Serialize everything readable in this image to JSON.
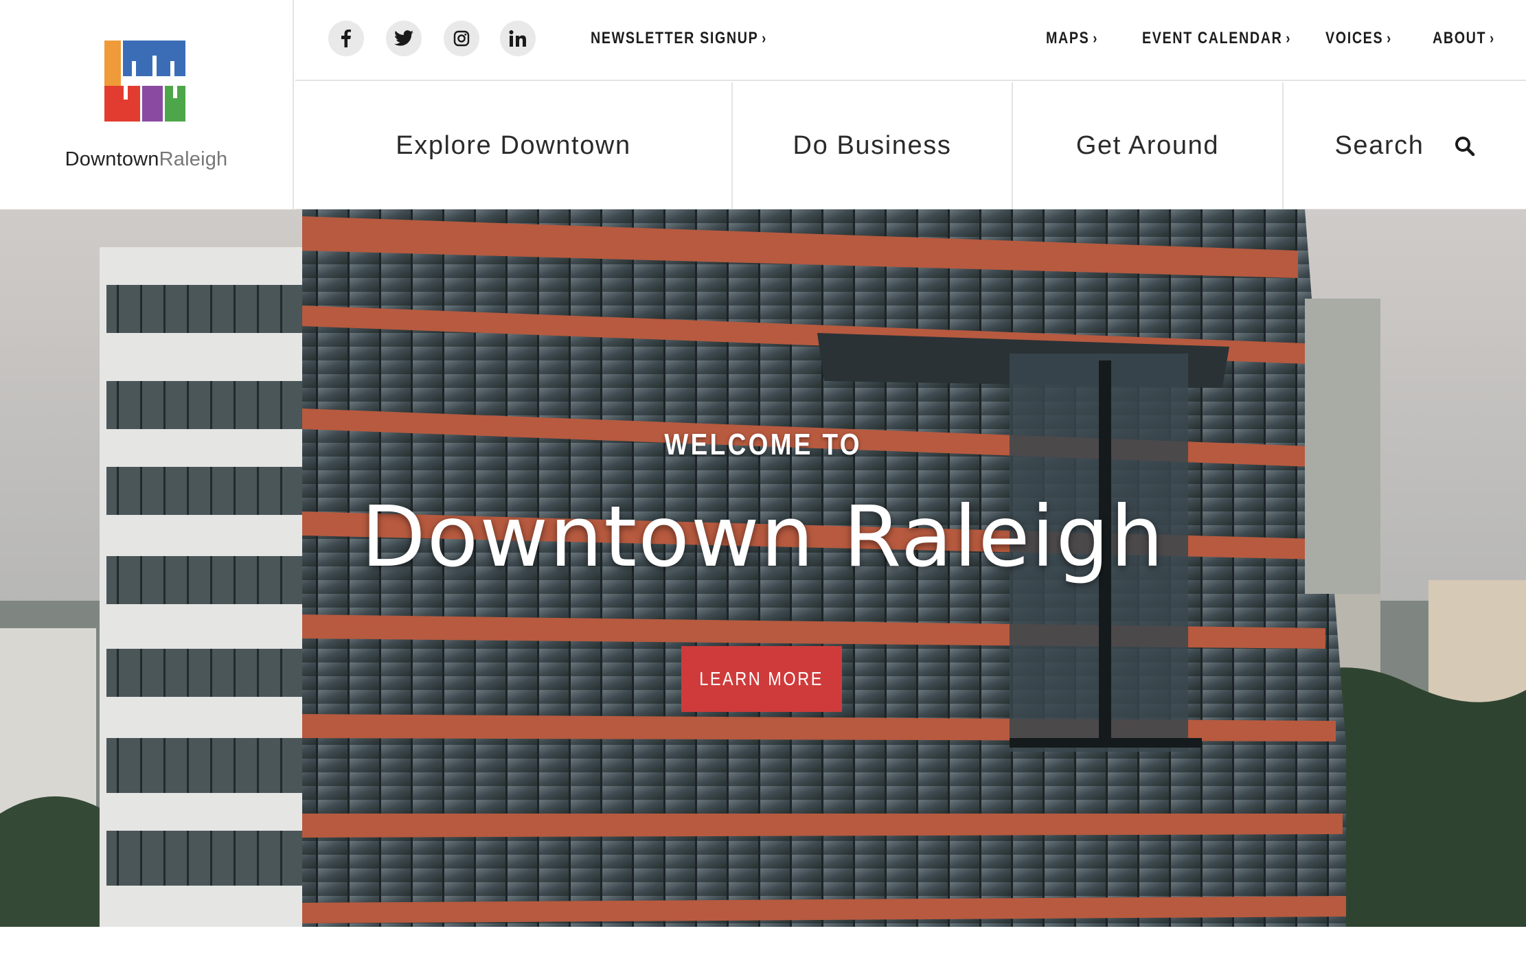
{
  "brand": {
    "wordmark_dark": "Downtown",
    "wordmark_light": "Raleigh",
    "logo_colors": [
      "#ef9b3a",
      "#3b6db7",
      "#e23c30",
      "#8a4aa1",
      "#4da64a"
    ]
  },
  "social": [
    {
      "name": "facebook-icon",
      "glyph": "f"
    },
    {
      "name": "twitter-icon",
      "glyph": "twitter"
    },
    {
      "name": "instagram-icon",
      "glyph": "instagram"
    },
    {
      "name": "linkedin-icon",
      "glyph": "in"
    }
  ],
  "utility": {
    "newsletter": "NEWSLETTER SIGNUP",
    "maps": "MAPS",
    "event_calendar": "EVENT CALENDAR",
    "voices": "VOICES",
    "about": "ABOUT"
  },
  "nav": {
    "explore": "Explore Downtown",
    "business": "Do Business",
    "get_around": "Get Around",
    "search": "Search"
  },
  "hero": {
    "eyebrow": "WELCOME TO",
    "title": "Downtown Raleigh",
    "cta": "LEARN MORE"
  },
  "colors": {
    "accent": "#cf3b3b",
    "building_band": "#b75a3f"
  }
}
